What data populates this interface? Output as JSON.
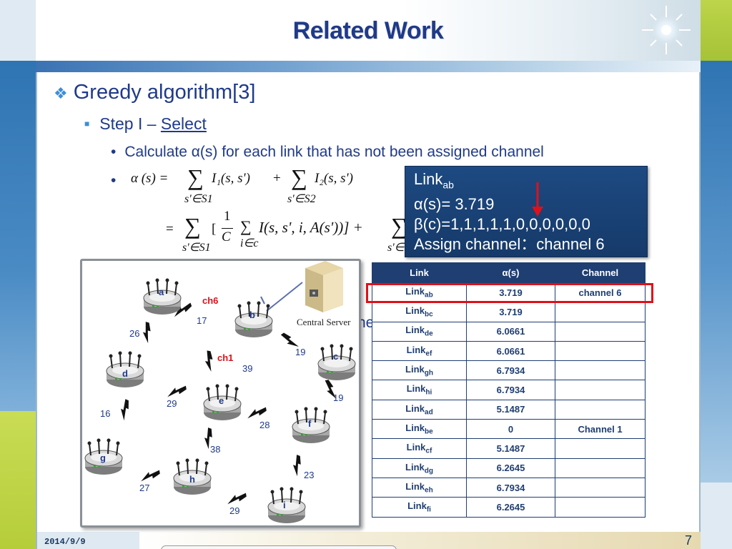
{
  "slide": {
    "title": "Related Work",
    "date": "2014/9/9",
    "page_number": "7"
  },
  "bullets": {
    "level1": "Greedy algorithm[3]",
    "level2_prefix": "Step  I – ",
    "level2_underlined": "Select",
    "level3": "Calculate α(s) for each link that has not been assigned channel"
  },
  "formula": {
    "line1_lhs": "α (s) =",
    "line1_t1": "I₁(s, s')",
    "line1_sub1": "s'∈S1",
    "line1_plus": "+",
    "line1_t2": "I₂(s, s')",
    "line1_sub2": "s'∈S2",
    "line2_eq": "=",
    "line2_sub1": "s'∈S1",
    "line2_bracket": "[",
    "line2_frac_num": "1",
    "line2_frac_den": "C",
    "line2_inner_sub": "i∈c",
    "line2_body": "I(s, s', i, A(s'))] +",
    "line2_sub2": "s'∈S"
  },
  "info_box": {
    "link_label": "Link",
    "link_sub": "ab",
    "alpha": "α(s)= 3.719",
    "beta": "β(c)=1,1,1,1,1,0,0,0,0,0,0",
    "assign": "Assign channel：channel 6"
  },
  "network": {
    "server_label": "Central Server",
    "nodes": [
      "a",
      "b",
      "c",
      "d",
      "e",
      "f",
      "g",
      "h",
      "i"
    ],
    "edge_labels": [
      "17",
      "26",
      "19",
      "39",
      "16",
      "29",
      "28",
      "19",
      "38",
      "27",
      "23",
      "29"
    ],
    "channel_labels": [
      "ch6",
      "ch1"
    ],
    "occluded_text": "ne"
  },
  "table": {
    "headers": [
      "Link",
      "α(s)",
      "Channel"
    ],
    "rows": [
      {
        "link": "Link",
        "sub": "ab",
        "alpha": "3.719",
        "channel": "channel 6"
      },
      {
        "link": "Link",
        "sub": "bc",
        "alpha": "3.719",
        "channel": ""
      },
      {
        "link": "Link",
        "sub": "de",
        "alpha": "6.0661",
        "channel": ""
      },
      {
        "link": "Link",
        "sub": "ef",
        "alpha": "6.0661",
        "channel": ""
      },
      {
        "link": "Link",
        "sub": "gh",
        "alpha": "6.7934",
        "channel": ""
      },
      {
        "link": "Link",
        "sub": "hi",
        "alpha": "6.7934",
        "channel": ""
      },
      {
        "link": "Link",
        "sub": "ad",
        "alpha": "5.1487",
        "channel": ""
      },
      {
        "link": "Link",
        "sub": "be",
        "alpha": "0",
        "channel": "Channel  1"
      },
      {
        "link": "Link",
        "sub": "cf",
        "alpha": "5.1487",
        "channel": ""
      },
      {
        "link": "Link",
        "sub": "dg",
        "alpha": "6.2645",
        "channel": ""
      },
      {
        "link": "Link",
        "sub": "eh",
        "alpha": "6.7934",
        "channel": ""
      },
      {
        "link": "Link",
        "sub": "fi",
        "alpha": "6.2645",
        "channel": ""
      }
    ]
  },
  "colors": {
    "title": "#1f3a8a",
    "accent_blue": "#3b73b3",
    "table_header": "#1f3e72",
    "highlight_red": "#e0101a",
    "left_bar_blue": "#3a7fb8",
    "left_bar_green": "#c5d94a"
  }
}
